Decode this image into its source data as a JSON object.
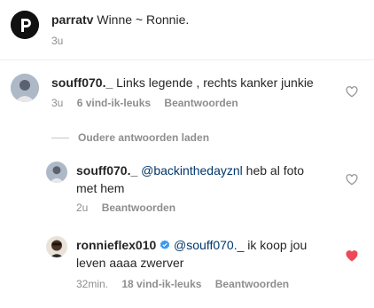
{
  "caption": {
    "username": "parratv",
    "text": "Winne ~ Ronnie.",
    "time": "3u"
  },
  "comments": [
    {
      "username": "souff070._",
      "text": "Links legende , rechts kanker junkie",
      "time": "3u",
      "likes": "6 vind-ik-leuks",
      "reply_label": "Beantwoorden",
      "liked": false
    }
  ],
  "load_older_replies": "Oudere antwoorden laden",
  "replies": [
    {
      "username": "souff070._",
      "mention": "@backinthedayznl",
      "text_line1": "heb al foto",
      "text_line2": "met hem",
      "time": "2u",
      "reply_label": "Beantwoorden",
      "liked": false
    },
    {
      "username": "ronnieflex010",
      "verified": true,
      "mention": "@souff070._",
      "text_line1": "ik koop jou",
      "text_line2": "leven aaaa zwerver",
      "time": "32min.",
      "likes": "18 vind-ik-leuks",
      "reply_label": "Beantwoorden",
      "liked": true
    }
  ],
  "colors": {
    "heart_liked": "#ed4956",
    "verified": "#3897f0",
    "mention": "#00376b"
  },
  "icons": [
    "avatar-parratv",
    "heart-outline-icon",
    "heart-filled-icon",
    "verified-badge-icon"
  ]
}
